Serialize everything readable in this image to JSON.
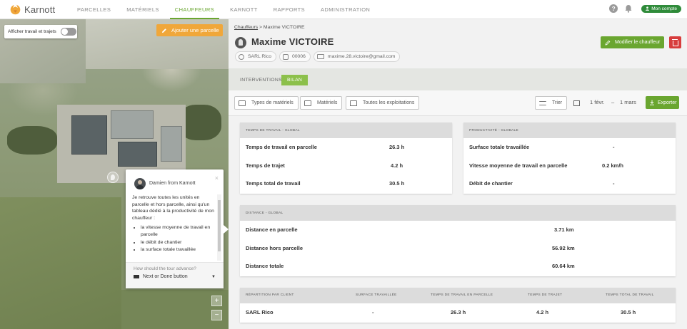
{
  "app": {
    "logo_text": "Karnott"
  },
  "nav": {
    "items": [
      {
        "label": "PARCELLES"
      },
      {
        "label": "MATÉRIELS"
      },
      {
        "label": "CHAUFFEURS"
      },
      {
        "label": "KARNOTT"
      },
      {
        "label": "RAPPORTS"
      },
      {
        "label": "ADMINISTRATION"
      }
    ],
    "active": "CHAUFFEURS",
    "help_glyph": "?",
    "account_label": "Mon compte"
  },
  "map": {
    "toggle_label": "Afficher travail et trajets",
    "toggle_on": false,
    "add_parcel_label": "Ajouter une parcelle",
    "zoom_in": "+",
    "zoom_out": "−"
  },
  "tour": {
    "from": "Damien from Karnott",
    "close": "×",
    "intro": "Je retrouve toutes les unités en parcelle et hors parcelle, ainsi qu'un tableau dédié à la productivité de mon chauffeur :",
    "bullets": [
      "la vitesse moyenne de travail en parcelle",
      "le débit de chantier",
      "la surface totale travaillée"
    ],
    "question": "How should the tour advance?",
    "advance_option": "Next or Done button"
  },
  "driver": {
    "breadcrumb_root": "Chauffeurs",
    "breadcrumb_sep": ">",
    "breadcrumb_current": "Maxime VICTOIRE",
    "name": "Maxime VICTOIRE",
    "company": "SARL Rico",
    "code": "00006",
    "email": "maxime.28.victoire@gmail.com",
    "edit_label": "Modifier le chauffeur"
  },
  "subtabs": {
    "interventions": "INTERVENTIONS",
    "bilan": "BILAN",
    "active": "BILAN"
  },
  "toolbar": {
    "types": "Types de matériels",
    "materiels": "Matériels",
    "exploitations": "Toutes les exploitations",
    "sort": "Trier",
    "date_from": "1 févr.",
    "date_sep": "–",
    "date_to": "1 mars",
    "export": "Exporter"
  },
  "time_card": {
    "header": "TEMPS DE TRAVAIL - GLOBAL",
    "rows": [
      {
        "label": "Temps de travail en parcelle",
        "value": "26.3 h"
      },
      {
        "label": "Temps de trajet",
        "value": "4.2 h"
      },
      {
        "label": "Temps total de travail",
        "value": "30.5 h"
      }
    ]
  },
  "prod_card": {
    "header": "PRODUCTIVITÉ - GLOBALE",
    "rows": [
      {
        "label": "Surface totale travaillée",
        "value": "-"
      },
      {
        "label": "Vitesse moyenne de travail en parcelle",
        "value": "0.2 km/h"
      },
      {
        "label": "Débit de chantier",
        "value": "-"
      }
    ]
  },
  "distance_card": {
    "header": "DISTANCE - GLOBAL",
    "rows": [
      {
        "label": "Distance en parcelle",
        "value": "3.71 km"
      },
      {
        "label": "Distance hors parcelle",
        "value": "56.92 km"
      },
      {
        "label": "Distance totale",
        "value": "60.64 km"
      }
    ]
  },
  "client_table": {
    "headers": [
      "RÉPARTITION PAR CLIENT",
      "SURFACE TRAVAILLÉE",
      "TEMPS DE TRAVAIL EN PARCELLE",
      "TEMPS DE TRAJET",
      "TEMPS TOTAL DE TRAVAIL"
    ],
    "rows": [
      [
        "SARL Rico",
        "-",
        "26.3 h",
        "4.2 h",
        "30.5 h"
      ]
    ]
  },
  "colors": {
    "brand_green": "#6aa630",
    "active_tab": "#8cc04b",
    "add_parcel": "#f0a73a",
    "delete": "#d73d3d",
    "account": "#2f8b3a"
  }
}
